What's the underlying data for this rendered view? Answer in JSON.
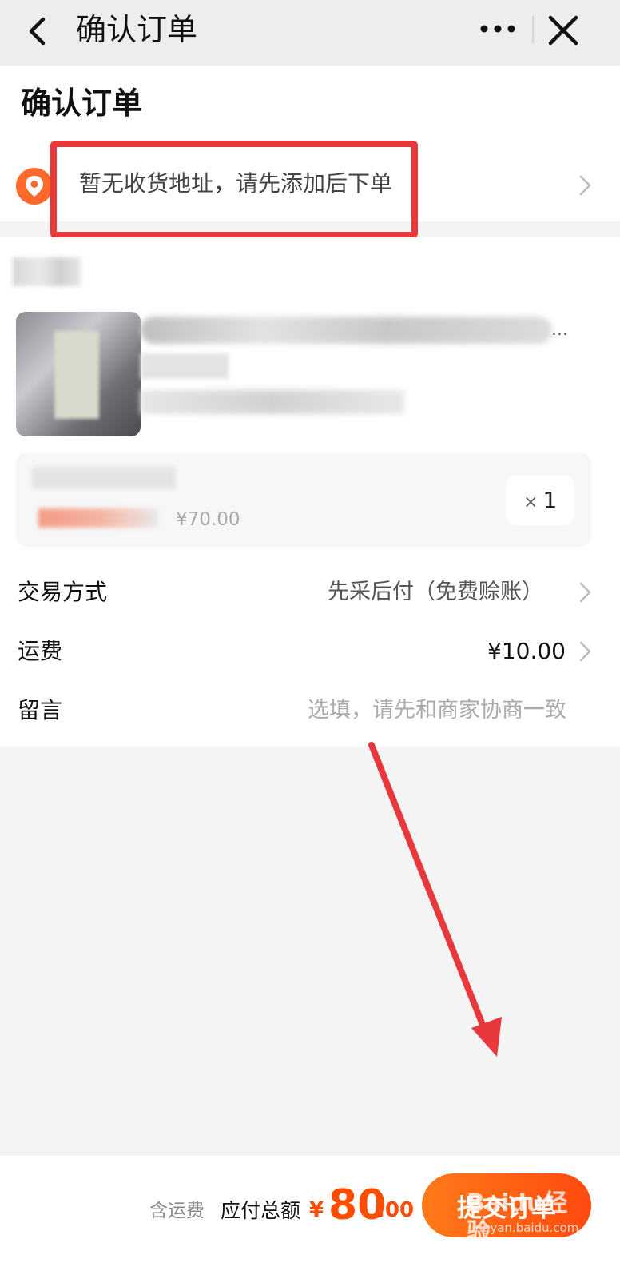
{
  "navbar": {
    "title": "确认订单",
    "back_icon": "chevron-left-icon",
    "more_icon": "more-dots-icon",
    "close_icon": "close-icon"
  },
  "page": {
    "title": "确认订单"
  },
  "address": {
    "icon": "location-pin-icon",
    "empty_text": "暂无收货地址，请先添加后下单",
    "icon_color": "#ff6a2c"
  },
  "product": {
    "title_suffix": "...",
    "sku_price": "¥70.00",
    "quantity_prefix": "×",
    "quantity": "1"
  },
  "order_rows": [
    {
      "label": "交易方式",
      "value": "先采后付（免费赊账）"
    },
    {
      "label": "运费",
      "value": "¥10.00"
    },
    {
      "label": "留言",
      "placeholder": "选填，请先和商家协商一致"
    }
  ],
  "footer": {
    "shipping_note": "含运费",
    "total_label": "应付总额",
    "currency": "¥",
    "total_integer": "80",
    "total_decimal": ".00",
    "submit_label": "提交订单",
    "accent_color": "#ff4d00"
  },
  "watermark": {
    "main": "Baidu经验",
    "sub": "jingyan.baidu.com"
  },
  "annotation": {
    "highlight_color": "#e8383c"
  }
}
